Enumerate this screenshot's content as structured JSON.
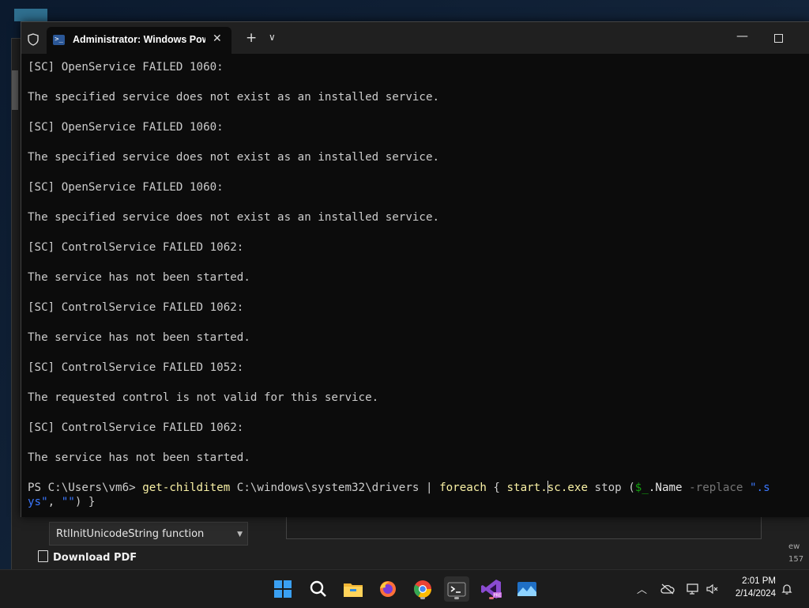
{
  "background": {
    "dropdown_row": "RtlInitUnicodeString function",
    "download_pdf": "Download PDF",
    "right_snippets": [
      "ew",
      "157"
    ]
  },
  "terminal": {
    "tab_title": "Administrator: Windows Powe",
    "tab_icon": "powershell-icon",
    "lines": [
      "[SC] OpenService FAILED 1060:",
      "The specified service does not exist as an installed service.",
      "[SC] OpenService FAILED 1060:",
      "The specified service does not exist as an installed service.",
      "[SC] OpenService FAILED 1060:",
      "The specified service does not exist as an installed service.",
      "[SC] ControlService FAILED 1062:",
      "The service has not been started.",
      "[SC] ControlService FAILED 1062:",
      "The service has not been started.",
      "[SC] ControlService FAILED 1052:",
      "The requested control is not valid for this service.",
      "[SC] ControlService FAILED 1062:",
      "The service has not been started."
    ],
    "prompt": {
      "ps": "PS C:\\Users\\vm6> ",
      "cmd1": "get-childitem",
      "path": " C:\\windows\\system32\\drivers ",
      "pipe": "| ",
      "cmd2": "foreach",
      "brace_open": " { ",
      "cmd3a": "start.",
      "cmd3b": "sc.exe",
      "stop": " stop (",
      "var": "$_",
      "name": ".Name ",
      "param": "-replace ",
      "str1a": "\".s",
      "str1b": "ys\"",
      "comma": ", ",
      "str2": "\"\"",
      "close": ") }"
    }
  },
  "taskbar": {
    "apps": [
      "windows-start-icon",
      "search-icon",
      "file-explorer-icon",
      "firefox-icon",
      "chrome-icon",
      "terminal-icon",
      "visual-studio-preview-icon",
      "photos-icon"
    ],
    "clock_time": "2:01 PM",
    "clock_date": "2/14/2024",
    "colors": {
      "win_blue": "#0078d4",
      "firefox_orange": "#ff7139",
      "chrome_red": "#ea4335",
      "vs_purple": "#68217a"
    }
  }
}
